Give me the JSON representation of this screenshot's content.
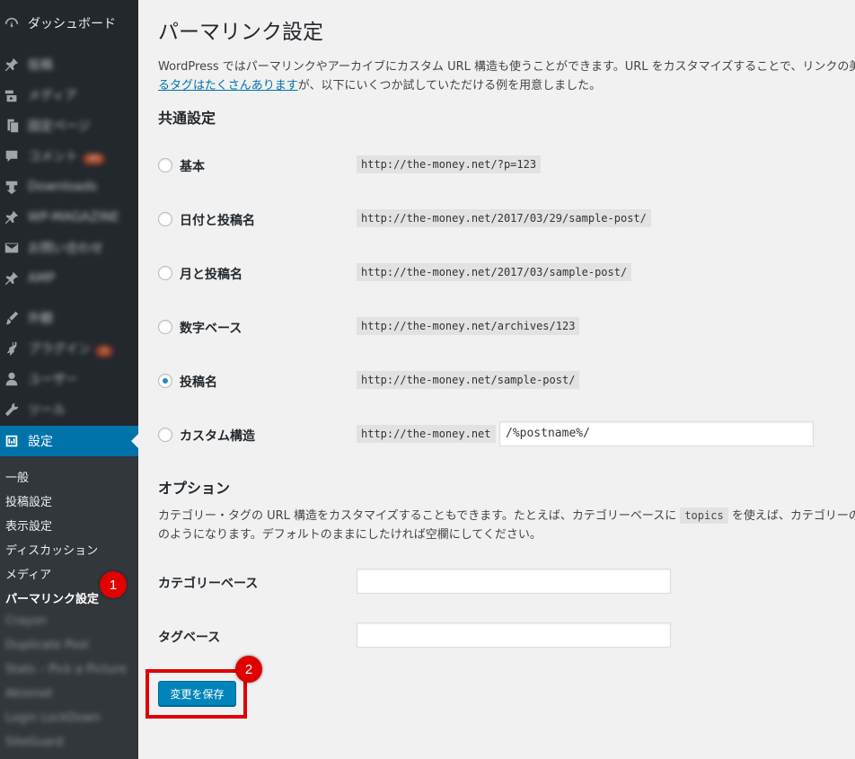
{
  "sidebar": {
    "dashboard": "ダッシュボード",
    "items": [
      {
        "label": "投稿",
        "icon": "pin-icon"
      },
      {
        "label": "メディア",
        "icon": "media-icon"
      },
      {
        "label": "固定ページ",
        "icon": "page-icon"
      },
      {
        "label": "コメント",
        "icon": "comment-icon",
        "badge": "99"
      },
      {
        "label": "Downloads",
        "icon": "download-icon"
      },
      {
        "label": "WP-MAGAZINE",
        "icon": "pin-icon"
      },
      {
        "label": "お問い合わせ",
        "icon": "mail-icon"
      },
      {
        "label": "AMP",
        "icon": "pin-icon"
      },
      {
        "label": "外観",
        "icon": "brush-icon"
      },
      {
        "label": "プラグイン",
        "icon": "plugin-icon",
        "badge": "3"
      },
      {
        "label": "ユーザー",
        "icon": "user-icon"
      },
      {
        "label": "ツール",
        "icon": "wrench-icon"
      }
    ],
    "settings": "設定",
    "submenu": [
      "一般",
      "投稿設定",
      "表示設定",
      "ディスカッション",
      "メディア",
      "パーマリンク設定"
    ],
    "blurred_submenu": [
      "Crayon",
      "Duplicate Post",
      "Stats – Pick a Picture",
      "Akismet",
      "Login LockDown",
      "SiteGuard"
    ]
  },
  "markers": {
    "one": "1",
    "two": "2"
  },
  "page": {
    "title": "パーマリンク設定",
    "intro_line1": "WordPress ではパーマリンクやアーカイブにカスタム URL 構造も使うことができます。URL をカスタマイズすることで、リンクの美し",
    "intro_link": "るタグはたくさんあります",
    "intro_line2_rest": "が、以下にいくつか試していただける例を用意しました。",
    "common_heading": "共通設定",
    "options": [
      {
        "label": "基本",
        "example": "http://the-money.net/?p=123",
        "checked": false
      },
      {
        "label": "日付と投稿名",
        "example": "http://the-money.net/2017/03/29/sample-post/",
        "checked": false
      },
      {
        "label": "月と投稿名",
        "example": "http://the-money.net/2017/03/sample-post/",
        "checked": false
      },
      {
        "label": "数字ベース",
        "example": "http://the-money.net/archives/123",
        "checked": false
      },
      {
        "label": "投稿名",
        "example": "http://the-money.net/sample-post/",
        "checked": true
      },
      {
        "label": "カスタム構造",
        "example": "http://the-money.net",
        "checked": false,
        "value": "/%postname%/"
      }
    ],
    "options_heading": "オプション",
    "options_desc_1": "カテゴリー・タグの URL 構造をカスタマイズすることもできます。たとえば、カテゴリーベースに ",
    "options_desc_code": "topics",
    "options_desc_2": " を使えば、カテゴリーの",
    "options_desc_line2": "のようになります。デフォルトのままにしたければ空欄にしてください。",
    "category_base_label": "カテゴリーベース",
    "tag_base_label": "タグベース",
    "save_label": "変更を保存"
  },
  "colors": {
    "sidebar": "#23282d",
    "active": "#0073aa",
    "marker": "#e00000",
    "button": "#0085ba"
  }
}
